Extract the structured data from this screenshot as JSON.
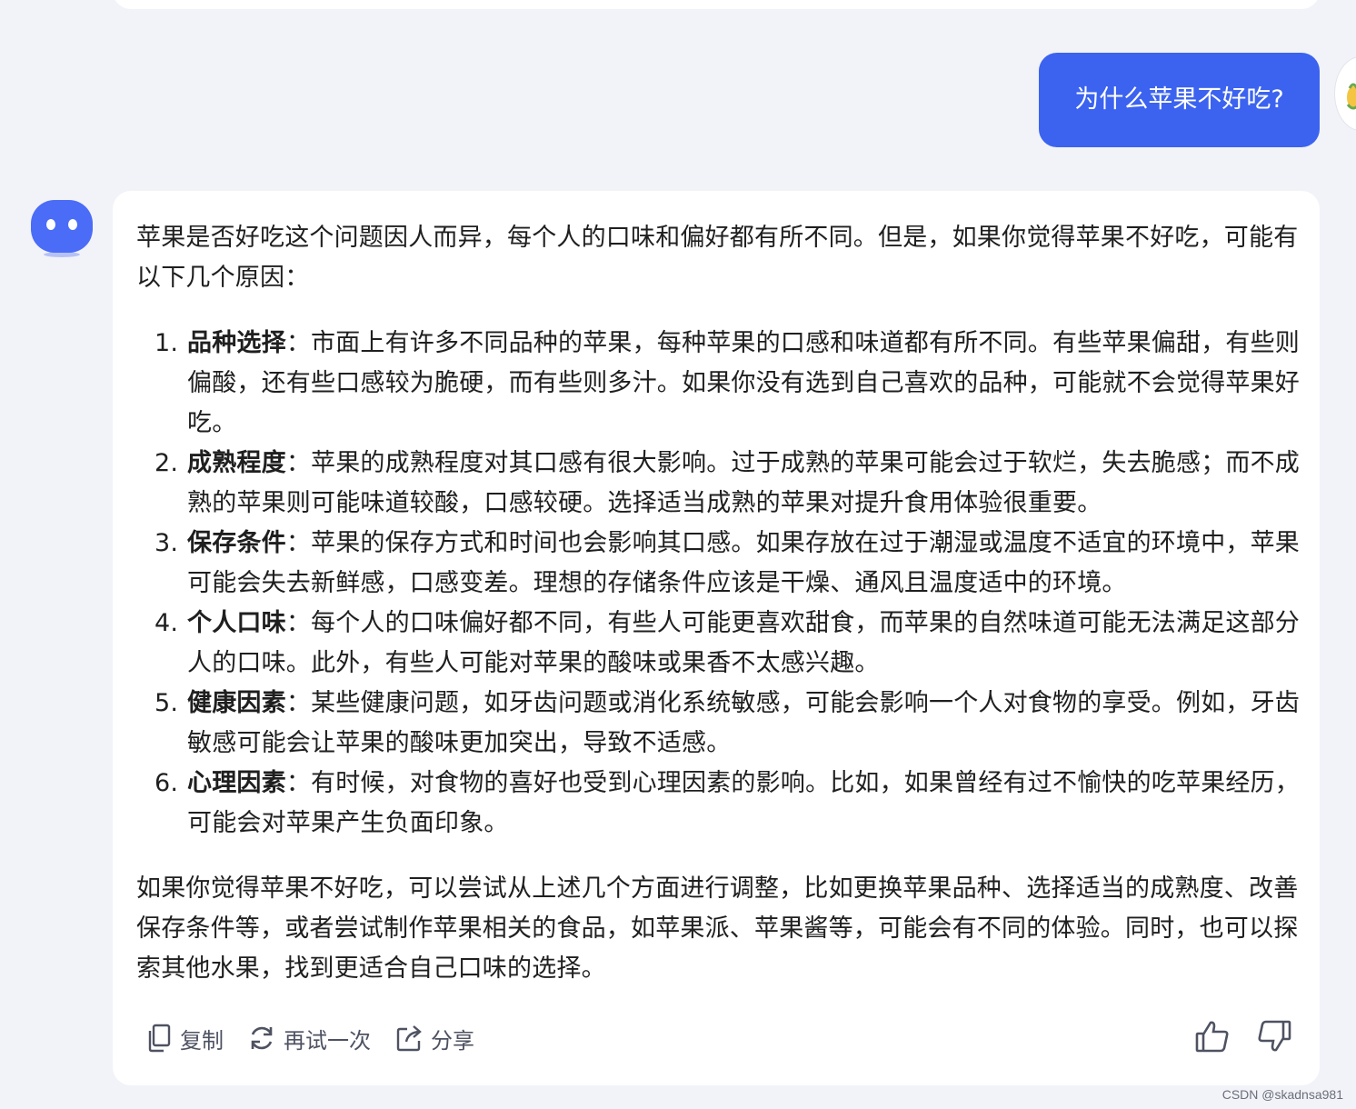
{
  "user_message": "为什么苹果不好吃?",
  "answer": {
    "intro": "苹果是否好吃这个问题因人而异，每个人的口味和偏好都有所不同。但是，如果你觉得苹果不好吃，可能有以下几个原因：",
    "reasons": [
      {
        "num": "1.",
        "term": "品种选择",
        "text": "：市面上有许多不同品种的苹果，每种苹果的口感和味道都有所不同。有些苹果偏甜，有些则偏酸，还有些口感较为脆硬，而有些则多汁。如果你没有选到自己喜欢的品种，可能就不会觉得苹果好吃。"
      },
      {
        "num": "2.",
        "term": "成熟程度",
        "text": "：苹果的成熟程度对其口感有很大影响。过于成熟的苹果可能会过于软烂，失去脆感；而不成熟的苹果则可能味道较酸，口感较硬。选择适当成熟的苹果对提升食用体验很重要。"
      },
      {
        "num": "3.",
        "term": "保存条件",
        "text": "：苹果的保存方式和时间也会影响其口感。如果存放在过于潮湿或温度不适宜的环境中，苹果可能会失去新鲜感，口感变差。理想的存储条件应该是干燥、通风且温度适中的环境。"
      },
      {
        "num": "4.",
        "term": "个人口味",
        "text": "：每个人的口味偏好都不同，有些人可能更喜欢甜食，而苹果的自然味道可能无法满足这部分人的口味。此外，有些人可能对苹果的酸味或果香不太感兴趣。"
      },
      {
        "num": "5.",
        "term": "健康因素",
        "text": "：某些健康问题，如牙齿问题或消化系统敏感，可能会影响一个人对食物的享受。例如，牙齿敏感可能会让苹果的酸味更加突出，导致不适感。"
      },
      {
        "num": "6.",
        "term": "心理因素",
        "text": "：有时候，对食物的喜好也受到心理因素的影响。比如，如果曾经有过不愉快的吃苹果经历，可能会对苹果产生负面印象。"
      }
    ],
    "conclusion": "如果你觉得苹果不好吃，可以尝试从上述几个方面进行调整，比如更换苹果品种、选择适当的成熟度、改善保存条件等，或者尝试制作苹果相关的食品，如苹果派、苹果酱等，可能会有不同的体验。同时，也可以探索其他水果，找到更适合自己口味的选择。"
  },
  "actions": {
    "copy": "复制",
    "retry": "再试一次",
    "share": "分享"
  },
  "feedback": {
    "like_icon": "thumbs-up-icon",
    "dislike_icon": "thumbs-down-icon"
  },
  "watermark": "CSDN @skadnsa981",
  "colors": {
    "background": "#f2f3f8",
    "user_bubble": "#3b63f0",
    "bot_avatar": "#4a6cf7",
    "card": "#ffffff"
  }
}
